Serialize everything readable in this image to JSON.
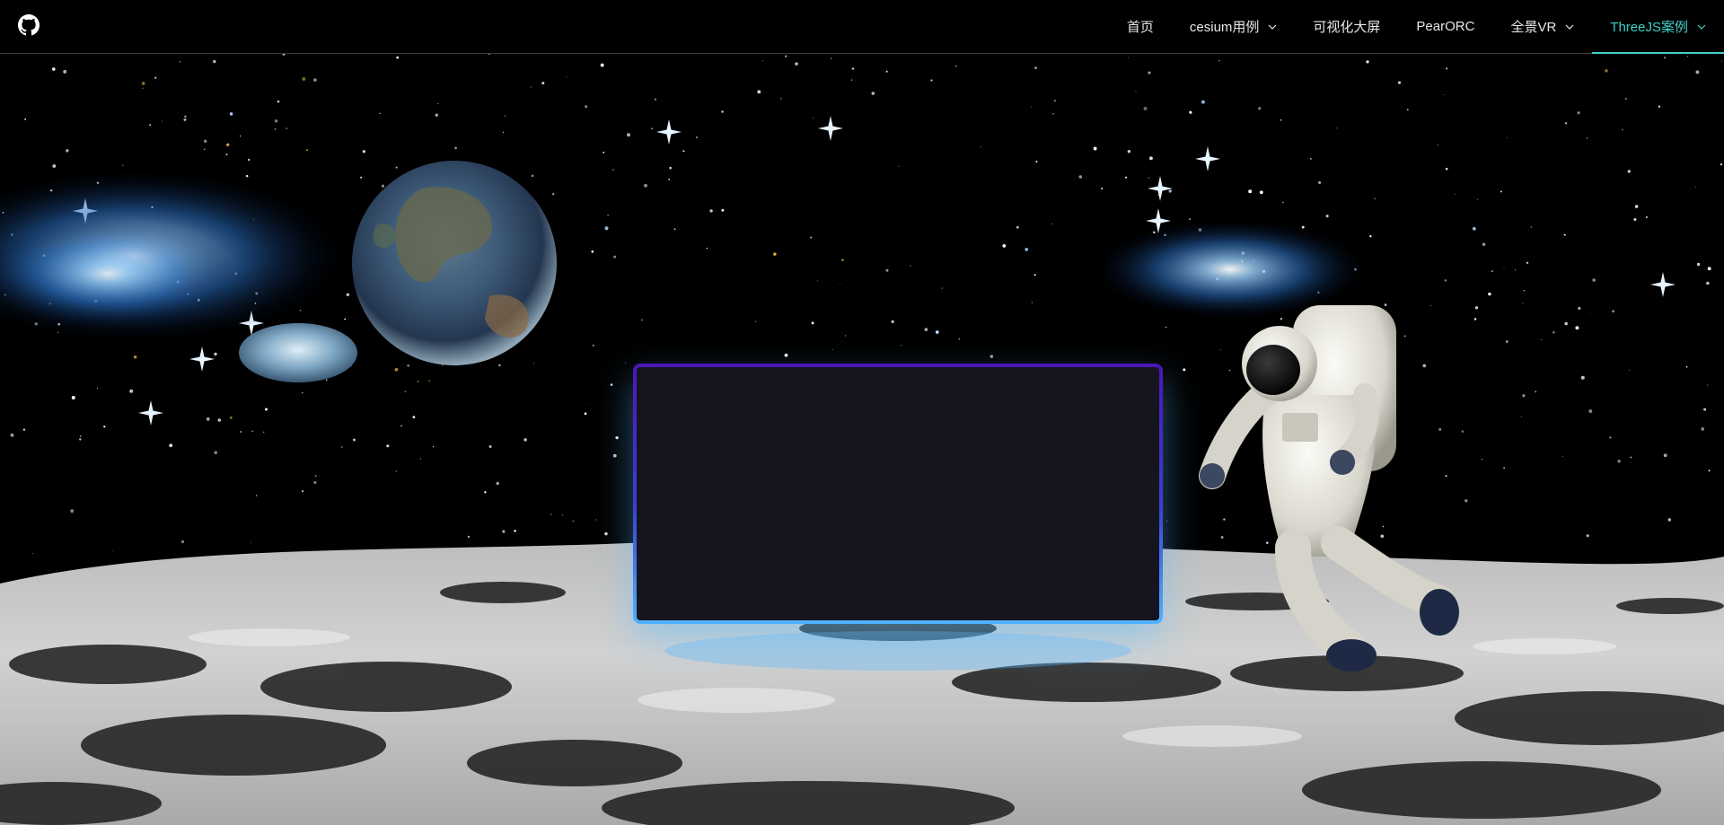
{
  "nav": {
    "logo_icon": "github-icon",
    "items": [
      {
        "label": "首页",
        "has_dropdown": false,
        "active": false
      },
      {
        "label": "cesium用例",
        "has_dropdown": true,
        "active": false
      },
      {
        "label": "可视化大屏",
        "has_dropdown": false,
        "active": false
      },
      {
        "label": "PearORC",
        "has_dropdown": false,
        "active": false
      },
      {
        "label": "全景VR",
        "has_dropdown": true,
        "active": false
      },
      {
        "label": "ThreeJS案例",
        "has_dropdown": true,
        "active": true
      }
    ],
    "active_color": "#3fd1c6"
  },
  "scene": {
    "elements": [
      "starfield",
      "nebula-left",
      "nebula-right",
      "earth",
      "small-planet",
      "astronaut",
      "moon-surface",
      "content-panel"
    ]
  },
  "panel": {
    "border_colors": [
      "#4b16b8",
      "#4fb3ff"
    ],
    "fill": "#14151f"
  }
}
